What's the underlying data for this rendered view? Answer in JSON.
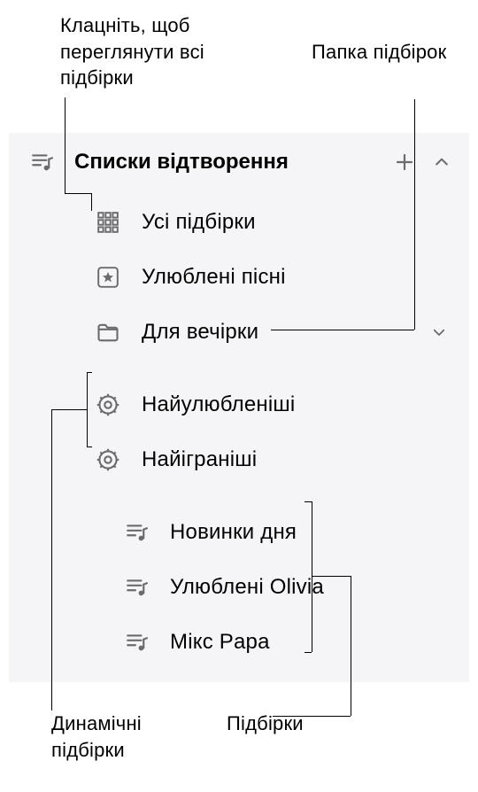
{
  "callouts": {
    "top_left": "Клацніть, щоб переглянути всі підбірки",
    "top_right": "Папка підбірок",
    "bottom_left_a": "Динамічні",
    "bottom_left_b": "підбірки",
    "bottom_right": "Підбірки"
  },
  "header": {
    "title": "Списки відтворення"
  },
  "rows": {
    "all": "Усі підбірки",
    "fav_songs": "Улюблені пісні",
    "party": "Для вечірки",
    "most_loved": "Найулюбленіші",
    "most_played": "Найіграніші",
    "new_today": "Новинки дня",
    "olivia_fav": "Улюблені Olivia",
    "mix_papa": "Мікс Papa"
  }
}
